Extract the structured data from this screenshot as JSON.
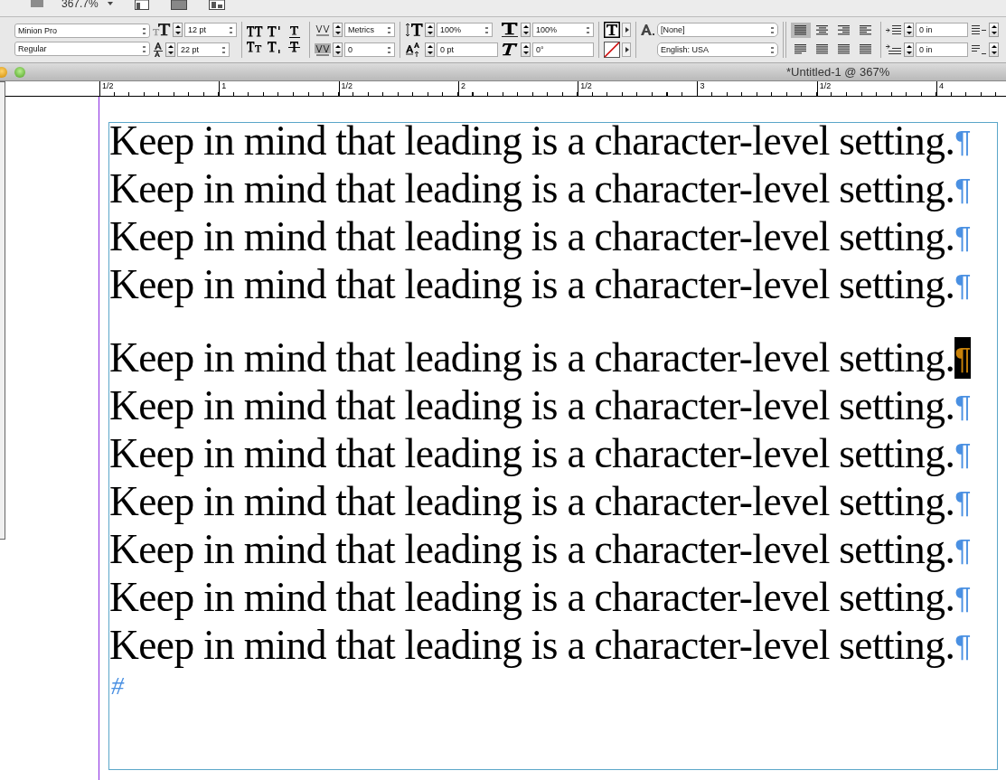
{
  "top_bar": {
    "zoom": "367.7%"
  },
  "control_panel": {
    "font_family": "Minion Pro",
    "font_style": "Regular",
    "font_size": "12 pt",
    "leading": "22 pt",
    "kerning": "Metrics",
    "tracking": "0",
    "vertical_scale": "100%",
    "horizontal_scale": "100%",
    "baseline_shift": "0 pt",
    "skew": "0°",
    "character_style": "[None]",
    "language": "English: USA",
    "left_indent": "0 in",
    "first_line_indent": "0 in",
    "align_buttons": [
      {
        "selected": true
      },
      {
        "selected": false
      },
      {
        "selected": false
      },
      {
        "selected": false
      },
      {
        "selected": false
      },
      {
        "selected": false
      },
      {
        "selected": false
      },
      {
        "selected": false
      }
    ]
  },
  "window": {
    "title": "*Untitled-1 @ 367%"
  },
  "ruler": [
    "1/2",
    "1",
    "1/2",
    "2",
    "1/2",
    "3",
    "1/2",
    "4"
  ],
  "text_frame": {
    "lines": [
      {
        "text": "Keep in mind that leading is a character-level setting.",
        "mark": "¶",
        "loose": false,
        "selected": false
      },
      {
        "text": "Keep in mind that leading is a character-level setting.",
        "mark": "¶",
        "loose": false,
        "selected": false
      },
      {
        "text": "Keep in mind that leading is a character-level setting.",
        "mark": "¶",
        "loose": false,
        "selected": false
      },
      {
        "text": "Keep in mind that leading is a character-level setting.",
        "mark": "¶",
        "loose": false,
        "selected": false
      },
      {
        "text": "Keep in mind that leading is a character-level setting.",
        "mark": "¶",
        "loose": true,
        "selected": true
      },
      {
        "text": "Keep in mind that leading is a character-level setting.",
        "mark": "¶",
        "loose": false,
        "selected": false
      },
      {
        "text": "Keep in mind that leading is a character-level setting.",
        "mark": "¶",
        "loose": false,
        "selected": false
      },
      {
        "text": "Keep in mind that leading is a character-level setting.",
        "mark": "¶",
        "loose": false,
        "selected": false
      },
      {
        "text": "Keep in mind that leading is a character-level setting.",
        "mark": "¶",
        "loose": false,
        "selected": false
      },
      {
        "text": "Keep in mind that leading is a character-level setting.",
        "mark": "¶",
        "loose": false,
        "selected": false
      },
      {
        "text": "Keep in mind that leading is a character-level setting.",
        "mark": "¶",
        "loose": false,
        "selected": false
      }
    ],
    "end_of_story": "#"
  }
}
